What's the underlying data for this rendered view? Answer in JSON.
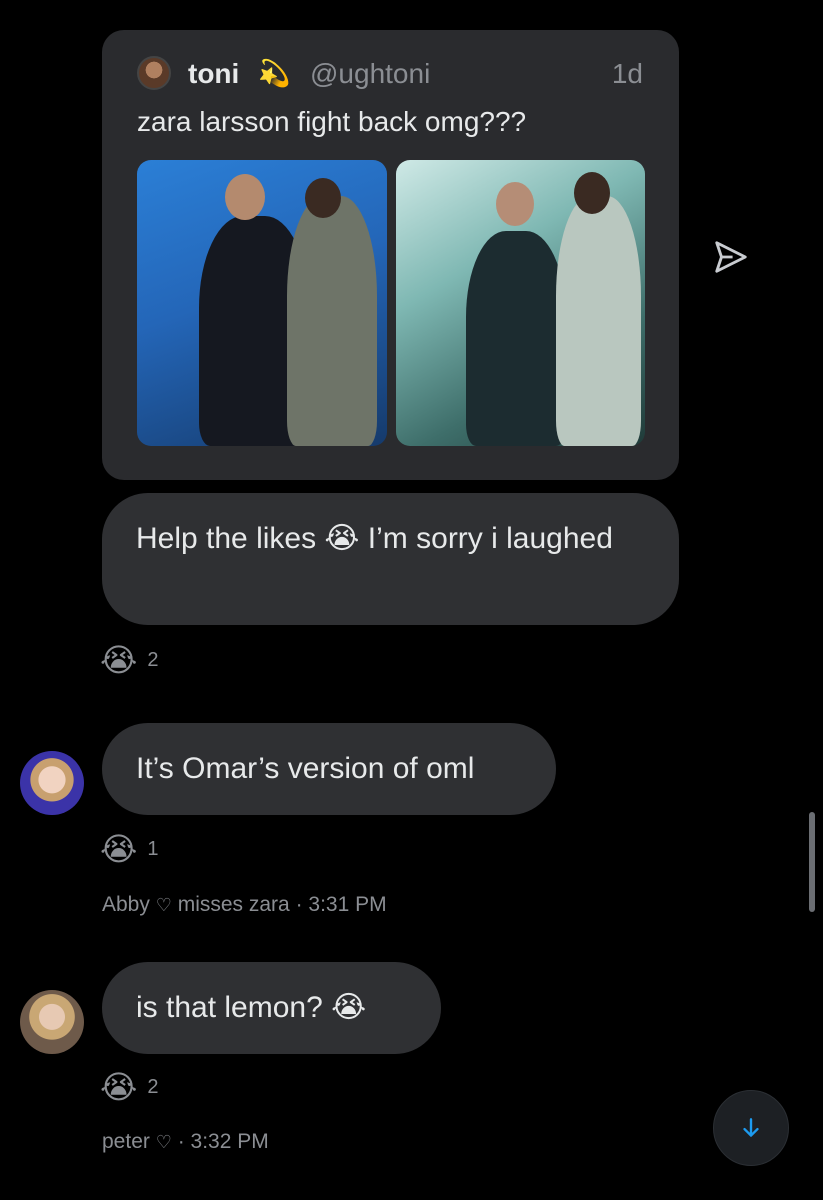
{
  "quoted_post": {
    "author_name": "toni",
    "author_emoji": "💫",
    "handle": "@ughtoni",
    "time": "1d",
    "text": "zara larsson fight back omg???",
    "media": [
      "photo",
      "photo"
    ]
  },
  "messages": [
    {
      "text": "Help the likes 😭 I’m sorry i laughed",
      "reaction": "😭",
      "reaction_count": "2"
    },
    {
      "text": "It’s Omar’s version of oml",
      "reaction": "😭",
      "reaction_count": "1",
      "meta_name": "Abby",
      "meta_status": "misses zara",
      "meta_time": "· 3:31 PM"
    },
    {
      "text": "is that lemon? 😭",
      "reaction": "😭",
      "reaction_count": "2",
      "meta_name": "peter",
      "meta_status": "",
      "meta_time": "· 3:32 PM"
    }
  ],
  "icons": {
    "share": "send-icon",
    "scroll": "arrow-down-icon",
    "heart": "heart-outline-icon"
  },
  "colors": {
    "accent": "#1d9bf0",
    "bubble": "#2f3033",
    "background": "#000000"
  }
}
